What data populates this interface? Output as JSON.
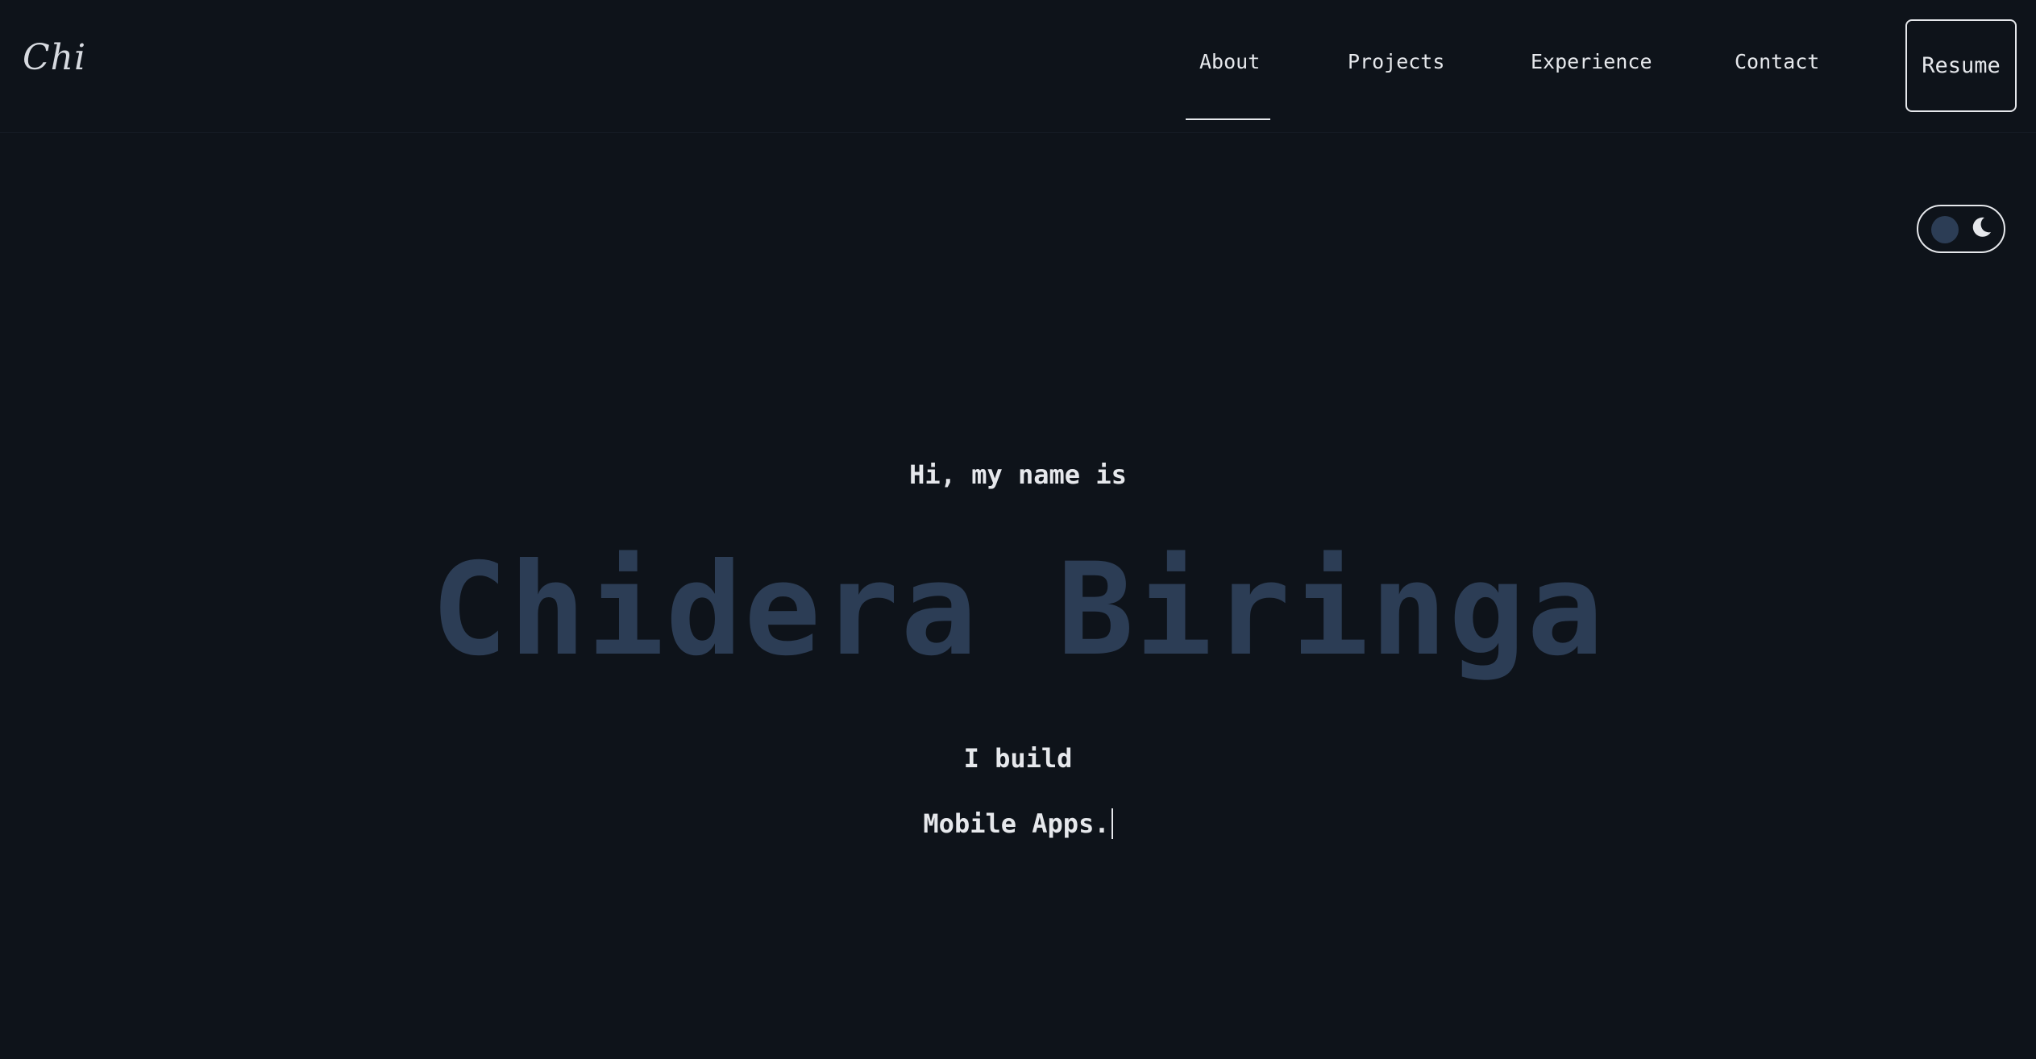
{
  "header": {
    "logo": "Chi",
    "nav": {
      "about": "About",
      "projects": "Projects",
      "experience": "Experience",
      "contact": "Contact"
    },
    "active_nav": "About",
    "resume_label": "Resume"
  },
  "theme_toggle": {
    "mode": "dark",
    "icon": "moon-icon"
  },
  "hero": {
    "greeting": "Hi, my name is",
    "name": "Chidera Biringa",
    "tagline": "I build",
    "typed_text": "Mobile Apps."
  },
  "colors": {
    "background": "#0e131a",
    "text": "#e6e8ec",
    "accent": "#2c3d55"
  }
}
